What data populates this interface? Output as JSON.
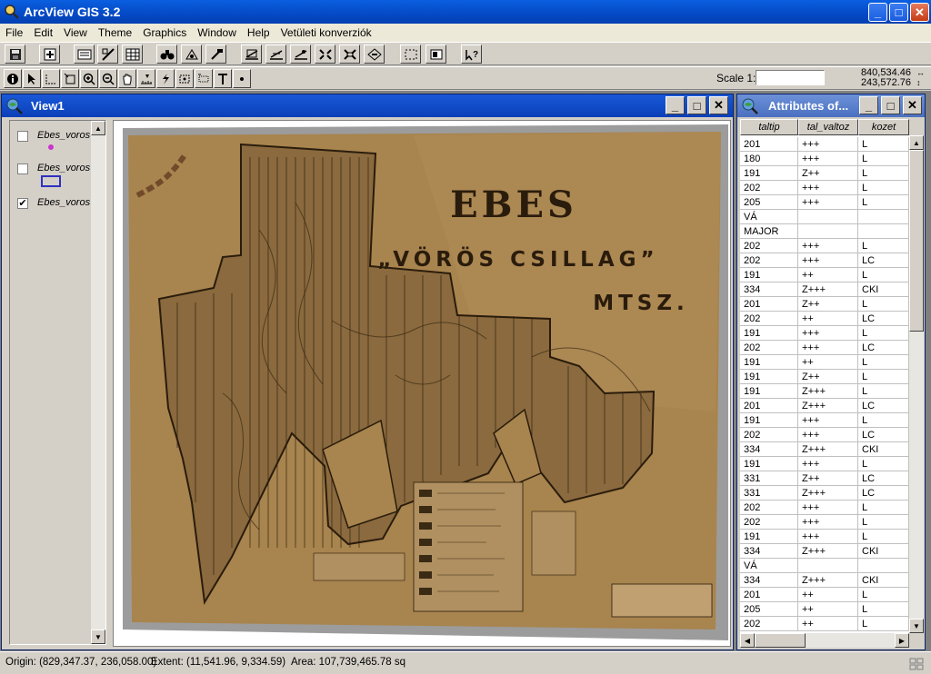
{
  "window": {
    "title": "ArcView GIS 3.2"
  },
  "menu": [
    "File",
    "Edit",
    "View",
    "Theme",
    "Graphics",
    "Window",
    "Help",
    "Vetületi konverziók"
  ],
  "scale": {
    "label": "Scale 1:",
    "value": ""
  },
  "coordinates": {
    "x": "840,534.46",
    "y": "243,572.76"
  },
  "view": {
    "title": "View1",
    "themes": [
      {
        "name": "Ebes_voros",
        "checked": false,
        "symbol": "point"
      },
      {
        "name": "Ebes_voros",
        "checked": false,
        "symbol": "polygon"
      },
      {
        "name": "Ebes_voros",
        "checked": true,
        "symbol": "image"
      }
    ],
    "map_text": {
      "title": "EBES",
      "subtitle": "„VÖRÖS CSILLAG”",
      "org": "MTSZ."
    }
  },
  "attributes": {
    "title": "Attributes of...",
    "columns": [
      "taltip",
      "tal_valtoz",
      "kozet"
    ],
    "rows": [
      [
        "201",
        "+++",
        "L"
      ],
      [
        "180",
        "+++",
        "L"
      ],
      [
        "191",
        "Z++",
        "L"
      ],
      [
        "202",
        "+++",
        "L"
      ],
      [
        "205",
        "+++",
        "L"
      ],
      [
        "VÁ",
        "",
        ""
      ],
      [
        "MAJOR",
        "",
        ""
      ],
      [
        "202",
        "+++",
        "L"
      ],
      [
        "202",
        "+++",
        "LC"
      ],
      [
        "191",
        "++",
        "L"
      ],
      [
        "334",
        "Z+++",
        "CKI"
      ],
      [
        "201",
        "Z++",
        "L"
      ],
      [
        "202",
        "++",
        "LC"
      ],
      [
        "191",
        "+++",
        "L"
      ],
      [
        "202",
        "+++",
        "LC"
      ],
      [
        "191",
        "++",
        "L"
      ],
      [
        "191",
        "Z++",
        "L"
      ],
      [
        "191",
        "Z+++",
        "L"
      ],
      [
        "201",
        "Z+++",
        "LC"
      ],
      [
        "191",
        "+++",
        "L"
      ],
      [
        "202",
        "+++",
        "LC"
      ],
      [
        "334",
        "Z+++",
        "CKI"
      ],
      [
        "191",
        "+++",
        "L"
      ],
      [
        "331",
        "Z++",
        "LC"
      ],
      [
        "331",
        "Z+++",
        "LC"
      ],
      [
        "202",
        "+++",
        "L"
      ],
      [
        "202",
        "+++",
        "L"
      ],
      [
        "191",
        "+++",
        "L"
      ],
      [
        "334",
        "Z+++",
        "CKI"
      ],
      [
        "VÁ",
        "",
        ""
      ],
      [
        "334",
        "Z+++",
        "CKI"
      ],
      [
        "201",
        "++",
        "L"
      ],
      [
        "205",
        "++",
        "L"
      ],
      [
        "202",
        "++",
        "L"
      ]
    ]
  },
  "status": {
    "origin": "Origin: (829,347.37, 236,058.00)",
    "extent": "Extent: (11,541.96, 9,334.59)",
    "area": "Area: 107,739,465.78 sq"
  },
  "colors": {
    "titlebar": "#0a5fe0",
    "map_paper": "#a8844e",
    "map_ink": "#2a1c0c",
    "point_symbol": "#cc33cc",
    "polygon_symbol": "#3030c0"
  }
}
